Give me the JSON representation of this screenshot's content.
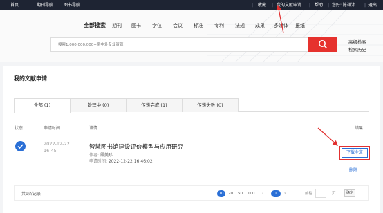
{
  "topbar": {
    "home": "首页",
    "journal_nav": "期刊导航",
    "book_nav": "图书导航",
    "favorites": "收藏",
    "my_requests": "我的文献申请",
    "help": "帮助",
    "greeting": "您好: 陈祥沛",
    "logout": "退出"
  },
  "search": {
    "tabs": [
      "全部搜索",
      "期刊",
      "图书",
      "学位",
      "会议",
      "标准",
      "专利",
      "法规",
      "成果",
      "多媒体",
      "报纸"
    ],
    "placeholder": "搜索1,000,000,000+条中外专业资源",
    "advanced": "高级检索",
    "history": "检索历史"
  },
  "page": {
    "title": "我的文献申请",
    "tabs": [
      "全部 (1)",
      "处理中 (0)",
      "传递完成 (1)",
      "传递失败 (0)"
    ]
  },
  "table": {
    "headers": {
      "status": "状态",
      "time": "申请时间",
      "detail": "详情",
      "result": "结果"
    },
    "rows": [
      {
        "date": "2022-12-22",
        "time": "16:45",
        "title": "智慧图书馆建设评价模型与应用研究",
        "author_label": "作者:",
        "author": "段美珍",
        "applied_label": "申请时间:",
        "applied": "2022-12-22 16:46:02",
        "download": "下载全文",
        "delete": "删除"
      }
    ]
  },
  "pagination": {
    "total": "共1条记录",
    "sizes": [
      "10",
      "20",
      "50",
      "100"
    ],
    "active_size": "10",
    "prev": "‹",
    "current": "1",
    "next": "›",
    "goto_label": "前往",
    "page_label": "页",
    "confirm": "确定"
  },
  "colors": {
    "accent": "#2a6fd6",
    "brand_red": "#e6322e",
    "topbar": "#1e2433",
    "annotation": "#e23030"
  }
}
